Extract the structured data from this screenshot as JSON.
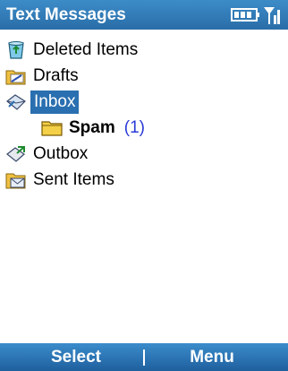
{
  "titlebar": {
    "title": "Text Messages",
    "icons": [
      "battery-icon",
      "signal-icon"
    ]
  },
  "folders": [
    {
      "label": "Deleted Items",
      "icon": "recycle-bin-icon"
    },
    {
      "label": "Drafts",
      "icon": "drafts-folder-icon"
    },
    {
      "label": "Inbox",
      "icon": "inbox-icon",
      "selected": true
    },
    {
      "label": "Spam",
      "icon": "folder-icon",
      "count": "(1)"
    },
    {
      "label": "Outbox",
      "icon": "outbox-icon"
    },
    {
      "label": "Sent Items",
      "icon": "sent-items-icon"
    }
  ],
  "softkeys": {
    "left": "Select",
    "right": "Menu"
  },
  "colors": {
    "titlebar_bg": "#2a6da8",
    "selection_bg": "#2a6fb0",
    "count_text": "#2b3bd6"
  }
}
